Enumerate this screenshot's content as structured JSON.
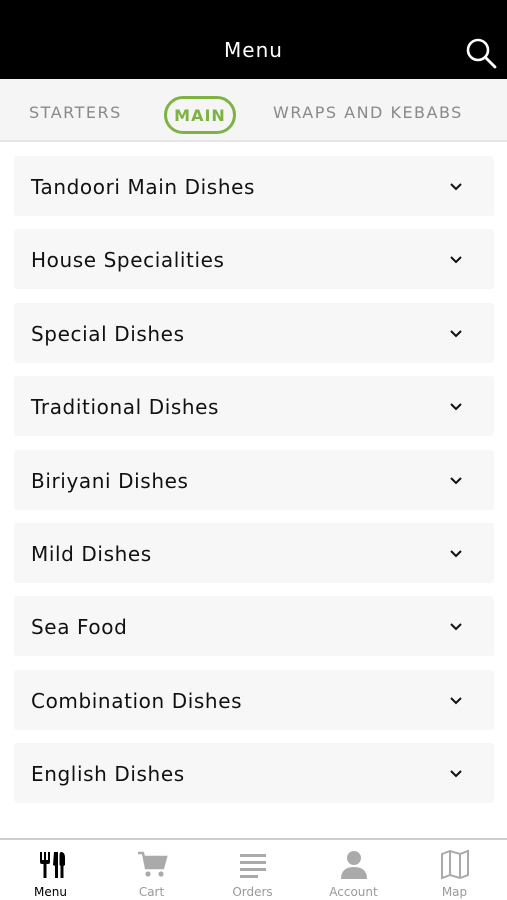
{
  "header": {
    "title": "Menu"
  },
  "tabs": {
    "starters": "STARTERS",
    "main": "MAIN",
    "wraps": "WRAPS AND KEBABS",
    "accent": "#7cb342"
  },
  "categories": [
    "Tandoori Main Dishes",
    "House Specialities",
    "Special Dishes",
    "Traditional Dishes",
    "Biriyani Dishes",
    "Mild Dishes",
    "Sea Food",
    "Combination Dishes",
    "English Dishes"
  ],
  "nav": {
    "menu": "Menu",
    "cart": "Cart",
    "orders": "Orders",
    "account": "Account",
    "map": "Map"
  },
  "icons": {
    "search": "search-icon",
    "menu": "cutlery-icon",
    "cart": "cart-icon",
    "orders": "list-icon",
    "account": "person-icon",
    "map": "map-icon"
  }
}
